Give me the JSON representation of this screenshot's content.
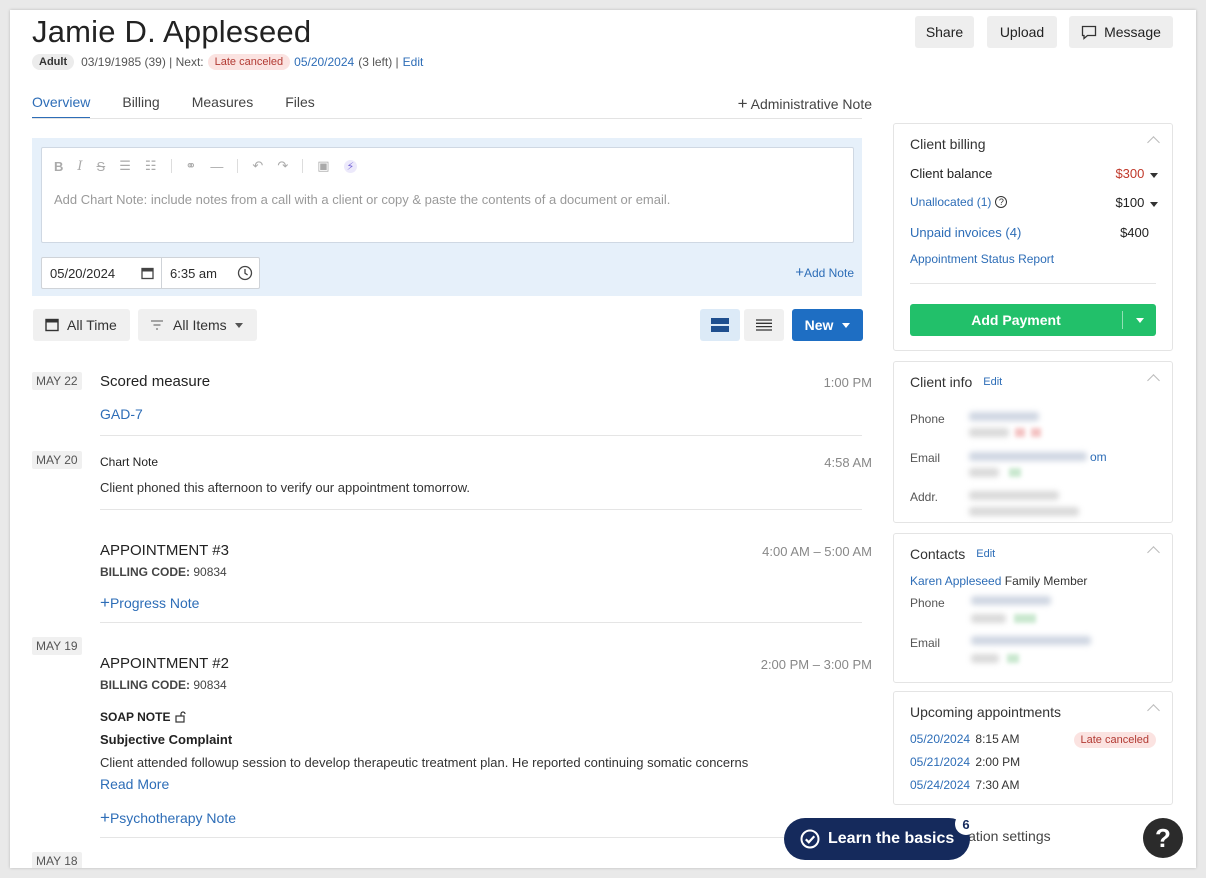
{
  "client": {
    "name": "Jamie D. Appleseed",
    "age_group": "Adult",
    "dob": "03/19/1985 (39) | Next:",
    "next_status": "Late canceled",
    "next_date": "05/20/2024",
    "left": "(3 left) |",
    "edit": "Edit"
  },
  "header": {
    "share": "Share",
    "upload": "Upload",
    "message": "Message"
  },
  "tabs": [
    "Overview",
    "Billing",
    "Measures",
    "Files"
  ],
  "admin_note": "Administrative Note",
  "editor": {
    "placeholder": "Add Chart Note: include notes from a call with a client or copy & paste the contents of a document or email.",
    "date": "05/20/2024",
    "time": "6:35 am",
    "add_note": "Add Note"
  },
  "filters": {
    "time": "All Time",
    "items": "All Items",
    "new": "New"
  },
  "timeline": {
    "d1": "MAY 22",
    "t1_title": "Scored measure",
    "t1_time": "1:00 PM",
    "t1_link": "GAD-7",
    "d2": "MAY 20",
    "t2_title": "Chart Note",
    "t2_time": "4:58 AM",
    "t2_text": "Client phoned this afternoon to verify our appointment tomorrow.",
    "t3_title": "APPOINTMENT #3",
    "t3_time": "4:00 AM – 5:00 AM",
    "t3_code_label": "BILLING CODE:",
    "t3_code": "90834",
    "t3_link": "Progress Note",
    "d3": "MAY 19",
    "t4_title": "APPOINTMENT #2",
    "t4_time": "2:00 PM – 3:00 PM",
    "t4_code_label": "BILLING CODE:",
    "t4_code": "90834",
    "t4_soap": "SOAP NOTE",
    "t4_subj": "Subjective Complaint",
    "t4_text": "Client attended followup session to develop therapeutic treatment plan. He reported continuing somatic concerns",
    "t4_read": "Read More",
    "t4_link": "Psychotherapy Note",
    "d4": "MAY 18"
  },
  "billing": {
    "title": "Client billing",
    "balance_label": "Client balance",
    "balance": "$300",
    "unallocated_label": "Unallocated (1)",
    "unallocated": "$100",
    "unpaid_label": "Unpaid invoices (4)",
    "unpaid": "$400",
    "report": "Appointment Status Report",
    "add_payment": "Add Payment"
  },
  "info": {
    "title": "Client info",
    "edit": "Edit",
    "phone": "Phone",
    "email": "Email",
    "email_suffix": "om",
    "addr": "Addr."
  },
  "contacts": {
    "title": "Contacts",
    "edit": "Edit",
    "name": "Karen Appleseed",
    "relation": "Family Member",
    "phone": "Phone",
    "email": "Email"
  },
  "upcoming": {
    "title": "Upcoming appointments",
    "a1_date": "05/20/2024",
    "a1_time": "8:15 AM",
    "a1_status": "Late canceled",
    "a2_date": "05/21/2024",
    "a2_time": "2:00 PM",
    "a3_date": "05/24/2024",
    "a3_time": "7:30 AM"
  },
  "notification": "ication settings",
  "learn": {
    "label": "Learn the basics",
    "count": "6"
  },
  "help": "?"
}
